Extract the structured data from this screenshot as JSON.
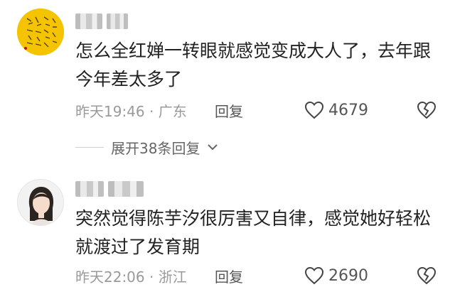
{
  "comments": [
    {
      "text": "怎么全红婵一转眼就感觉变成大人了，去年跟今年差太多了",
      "time_location": "昨天19:46 · 广东",
      "reply_label": "回复",
      "likes": "4679",
      "avatar_icon": "calligraphy-avatar-icon"
    },
    {
      "text": "突然觉得陈芋汐很厉害又自律，感觉她好轻松就渡过了发育期",
      "time_location": "昨天22:06 · 浙江",
      "reply_label": "回复",
      "likes": "2690",
      "avatar_icon": "portrait-avatar-icon"
    }
  ],
  "expand_replies": "展开38条回复",
  "colors": {
    "text": "#222222",
    "meta": "#9a9a9a",
    "accent": "#f5c400"
  }
}
